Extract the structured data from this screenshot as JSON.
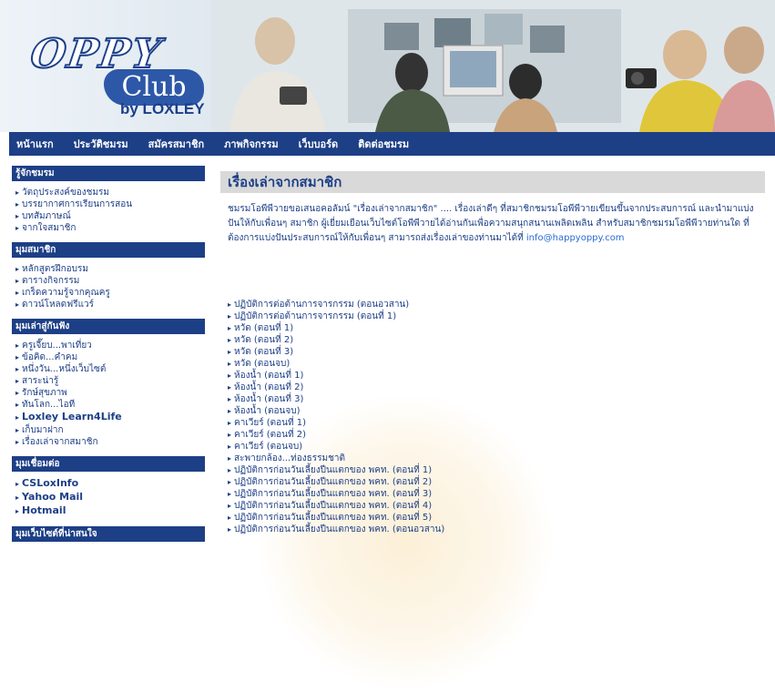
{
  "logo": {
    "oppy": "OPPY",
    "club": "Club",
    "by": "by LOXLEY"
  },
  "nav": [
    "หน้าแรก",
    "ประวัติชมรม",
    "สมัครสมาชิก",
    "ภาพกิจกรรม",
    "เว็บบอร์ด",
    "ติดต่อชมรม"
  ],
  "sidebar": {
    "sections": [
      {
        "title": "รู้จักชมรม",
        "items": [
          "วัตถุประสงค์ของชมรม",
          "บรรยากาศการเรียนการสอน",
          "บทสัมภาษณ์",
          "จากใจสมาชิก"
        ]
      },
      {
        "title": "มุมสมาชิก",
        "items": [
          "หลักสูตรฝึกอบรม",
          "ตารางกิจกรรม",
          "เกร็ดความรู้จากคุณครู",
          "ดาวน์โหลดฟรีแวร์"
        ]
      },
      {
        "title": "มุมเล่าสู่กันฟัง",
        "items": [
          "ครูเจี๊ยบ...พาเที่ยว",
          "ข้อคิด...คำคม",
          "หนึ่งวัน...หนึ่งเว็บไซต์",
          "สาระน่ารู้",
          "รักษ์สุขภาพ",
          "ทันโลก...ไอที",
          "Loxley Learn4Life",
          "เก็บมาฝาก",
          "เรื่องเล่าจากสมาชิก"
        ]
      },
      {
        "title": "มุมเชื่อมต่อ",
        "items": [
          "CSLoxInfo",
          "Yahoo Mail",
          "Hotmail"
        ]
      },
      {
        "title": "มุมเว็บไซต์ที่น่าสนใจ",
        "items": []
      }
    ]
  },
  "main": {
    "title": "เรื่องเล่าจากสมาชิก",
    "intro": "ชมรมโอพีพีวายขอเสนอคอลัมน์ \"เรื่องเล่าจากสมาชิก\" .... เรื่องเล่าดีๆ ที่สมาชิกชมรมโอพีพีวายเขียนขึ้นจากประสบการณ์ และนำมาแบ่งปันให้กับเพื่อนๆ สมาชิก ผู้เยี่ยมเยือนเว็บไซต์โอพีพีวายได้อ่านกันเพื่อความสนุกสนานเพลิดเพลิน สำหรับสมาชิกชมรมโอพีพีวายท่านใด ที่ต้องการแบ่งปันประสบการณ์ให้กับเพื่อนๆ สามารถส่งเรื่องเล่าของท่านมาได้ที่",
    "email": "info@happyoppy.com",
    "stories": [
      "ปฏิบัติการต่อต้านการจารกรรม (ตอนอวสาน)",
      "ปฏิบัติการต่อต้านการจารกรรม (ตอนที่ 1)",
      "หวัด (ตอนที่ 1)",
      "หวัด (ตอนที่ 2)",
      "หวัด (ตอนที่ 3)",
      "หวัด (ตอนจบ)",
      "ห้องน้ำ (ตอนที่ 1)",
      "ห้องน้ำ (ตอนที่ 2)",
      "ห้องน้ำ (ตอนที่ 3)",
      "ห้องน้ำ (ตอนจบ)",
      "คาเวียร์ (ตอนที่ 1)",
      "คาเวียร์ (ตอนที่ 2)",
      "คาเวียร์ (ตอนจบ)",
      "สะพายกล้อง...ท่องธรรมชาติ",
      "ปฏิบัติการก่อนวันเลี้ยงปีนแตกของ พคท. (ตอนที่ 1)",
      "ปฏิบัติการก่อนวันเลี้ยงปีนแตกของ พคท. (ตอนที่ 2)",
      "ปฏิบัติการก่อนวันเลี้ยงปีนแตกของ พคท. (ตอนที่ 3)",
      "ปฏิบัติการก่อนวันเลี้ยงปีนแตกของ พคท. (ตอนที่ 4)",
      "ปฏิบัติการก่อนวันเลี้ยงปีนแตกของ พคท. (ตอนที่ 5)",
      "ปฏิบัติการก่อนวันเลี้ยงปีนแตกของ พคท. (ตอนอวสาน)"
    ]
  },
  "colors": {
    "navy": "#1d3f86",
    "title_bg": "#d9d9d9",
    "email": "#2a6ad0"
  }
}
